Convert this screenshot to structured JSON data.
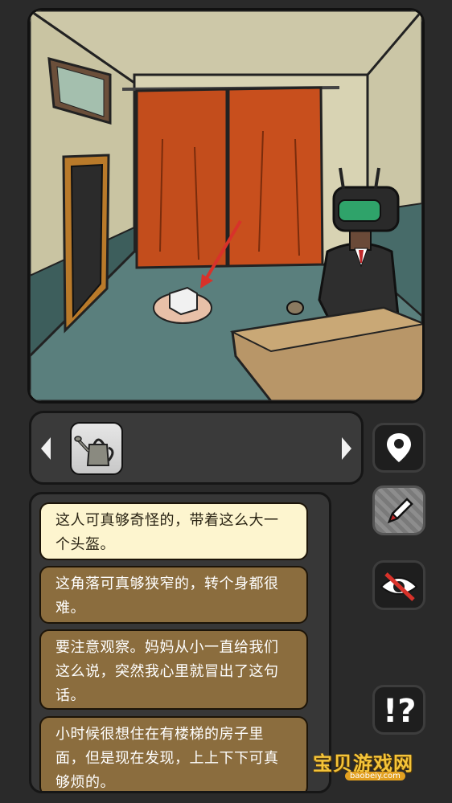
{
  "scene": {
    "description_hidden": ""
  },
  "inventory": {
    "items": [
      {
        "icon": "watering-can-icon"
      }
    ]
  },
  "sidebar": {
    "buttons": [
      {
        "icon": "map-pin-icon"
      },
      {
        "icon": "pencil-icon"
      },
      {
        "icon": "eye-crossed-icon"
      },
      {
        "icon": "exclamation-question-icon"
      }
    ]
  },
  "thoughts": [
    {
      "text": "这人可真够奇怪的，带着这么大一个头盔。",
      "selected": true
    },
    {
      "text": "这角落可真够狭窄的，转个身都很难。",
      "selected": false
    },
    {
      "text": "要注意观察。妈妈从小一直给我们这么说，突然我心里就冒出了这句话。",
      "selected": false
    },
    {
      "text": "小时候很想住在有楼梯的房子里面，但是现在发现，上上下下可真够烦的。",
      "selected": false
    }
  ],
  "watermark": {
    "title": "宝贝游戏网",
    "url": "baobeiy.com"
  }
}
